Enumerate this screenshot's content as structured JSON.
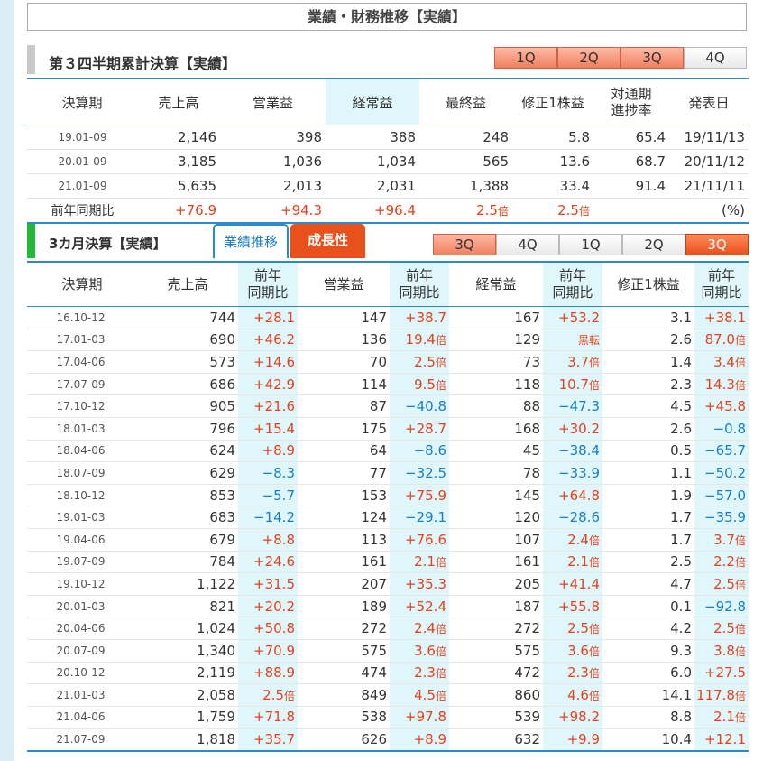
{
  "page_title": "業績・財務推移【実績】",
  "cumulative": {
    "title": "第３四半期累計決算【実績】",
    "tabs": [
      "1Q",
      "2Q",
      "3Q",
      "4Q"
    ],
    "headers": [
      "決算期",
      "売上高",
      "営業益",
      "経常益",
      "最終益",
      "修正1株益",
      "対通期\n進捗率",
      "発表日"
    ],
    "rows": [
      {
        "period": "19.01-09",
        "sales": "2,146",
        "op": "398",
        "ord": "388",
        "net": "248",
        "eps": "5.8",
        "prog": "65.4",
        "date": "19/11/13"
      },
      {
        "period": "20.01-09",
        "sales": "3,185",
        "op": "1,036",
        "ord": "1,034",
        "net": "565",
        "eps": "13.6",
        "prog": "68.7",
        "date": "20/11/12"
      },
      {
        "period": "21.01-09",
        "sales": "5,635",
        "op": "2,013",
        "ord": "2,031",
        "net": "1,388",
        "eps": "33.4",
        "prog": "91.4",
        "date": "21/11/11"
      }
    ],
    "yoy_row": {
      "label": "前年同期比",
      "sales": "+76.9",
      "op": "+94.3",
      "ord": "+96.4",
      "net": "2.5",
      "net_unit": "倍",
      "eps": "2.5",
      "eps_unit": "倍",
      "unit": "(%)"
    }
  },
  "quarterly": {
    "title": "3カ月決算【実績】",
    "view_tabs": [
      "業績推移",
      "成長性"
    ],
    "qtabs": [
      "3Q",
      "4Q",
      "1Q",
      "2Q",
      "3Q"
    ],
    "headers": [
      "決算期",
      "売上高",
      "前年\n同期比",
      "営業益",
      "前年\n同期比",
      "経常益",
      "前年\n同期比",
      "修正1株益",
      "前年\n同期比"
    ],
    "rows": [
      [
        "16.10-12",
        "744",
        "+28.1",
        "147",
        "+38.7",
        "167",
        "+53.2",
        "3.1",
        "+38.1"
      ],
      [
        "17.01-03",
        "690",
        "+46.2",
        "136",
        "19.4倍",
        "129",
        "黒転",
        "2.6",
        "87.0倍"
      ],
      [
        "17.04-06",
        "573",
        "+14.6",
        "70",
        "2.5倍",
        "73",
        "3.7倍",
        "1.4",
        "3.4倍"
      ],
      [
        "17.07-09",
        "686",
        "+42.9",
        "114",
        "9.5倍",
        "118",
        "10.7倍",
        "2.3",
        "14.3倍"
      ],
      [
        "17.10-12",
        "905",
        "+21.6",
        "87",
        "−40.8",
        "88",
        "−47.3",
        "4.5",
        "+45.8"
      ],
      [
        "18.01-03",
        "796",
        "+15.4",
        "175",
        "+28.7",
        "168",
        "+30.2",
        "2.6",
        "−0.8"
      ],
      [
        "18.04-06",
        "624",
        "+8.9",
        "64",
        "−8.6",
        "45",
        "−38.4",
        "0.5",
        "−65.7"
      ],
      [
        "18.07-09",
        "629",
        "−8.3",
        "77",
        "−32.5",
        "78",
        "−33.9",
        "1.1",
        "−50.2"
      ],
      [
        "18.10-12",
        "853",
        "−5.7",
        "153",
        "+75.9",
        "145",
        "+64.8",
        "1.9",
        "−57.0"
      ],
      [
        "19.01-03",
        "683",
        "−14.2",
        "124",
        "−29.1",
        "120",
        "−28.6",
        "1.7",
        "−35.9"
      ],
      [
        "19.04-06",
        "679",
        "+8.8",
        "113",
        "+76.6",
        "107",
        "2.4倍",
        "1.7",
        "3.7倍"
      ],
      [
        "19.07-09",
        "784",
        "+24.6",
        "161",
        "2.1倍",
        "161",
        "2.1倍",
        "2.5",
        "2.2倍"
      ],
      [
        "19.10-12",
        "1,122",
        "+31.5",
        "207",
        "+35.3",
        "205",
        "+41.4",
        "4.7",
        "2.5倍"
      ],
      [
        "20.01-03",
        "821",
        "+20.2",
        "189",
        "+52.4",
        "187",
        "+55.8",
        "0.1",
        "−92.8"
      ],
      [
        "20.04-06",
        "1,024",
        "+50.8",
        "272",
        "2.4倍",
        "272",
        "2.5倍",
        "4.2",
        "2.5倍"
      ],
      [
        "20.07-09",
        "1,340",
        "+70.9",
        "575",
        "3.6倍",
        "575",
        "3.6倍",
        "9.3",
        "3.8倍"
      ],
      [
        "20.10-12",
        "2,119",
        "+88.9",
        "474",
        "2.3倍",
        "472",
        "2.3倍",
        "6.0",
        "+27.5"
      ],
      [
        "21.01-03",
        "2,058",
        "2.5倍",
        "849",
        "4.5倍",
        "860",
        "4.6倍",
        "14.1",
        "117.8倍"
      ],
      [
        "21.04-06",
        "1,759",
        "+71.8",
        "538",
        "+97.8",
        "539",
        "+98.2",
        "8.8",
        "2.1倍"
      ],
      [
        "21.07-09",
        "1,818",
        "+35.7",
        "626",
        "+8.9",
        "632",
        "+9.9",
        "10.4",
        "+12.1"
      ]
    ]
  },
  "colors": {
    "accent_blue": "#2a8ad0",
    "positive": "#e8401c",
    "negative": "#1a7dc4",
    "highlight": "#dff7fb",
    "tab_orange": "#e8501c",
    "sec1_bar": "#c8c8c8",
    "sec2_bar": "#22bb33"
  }
}
